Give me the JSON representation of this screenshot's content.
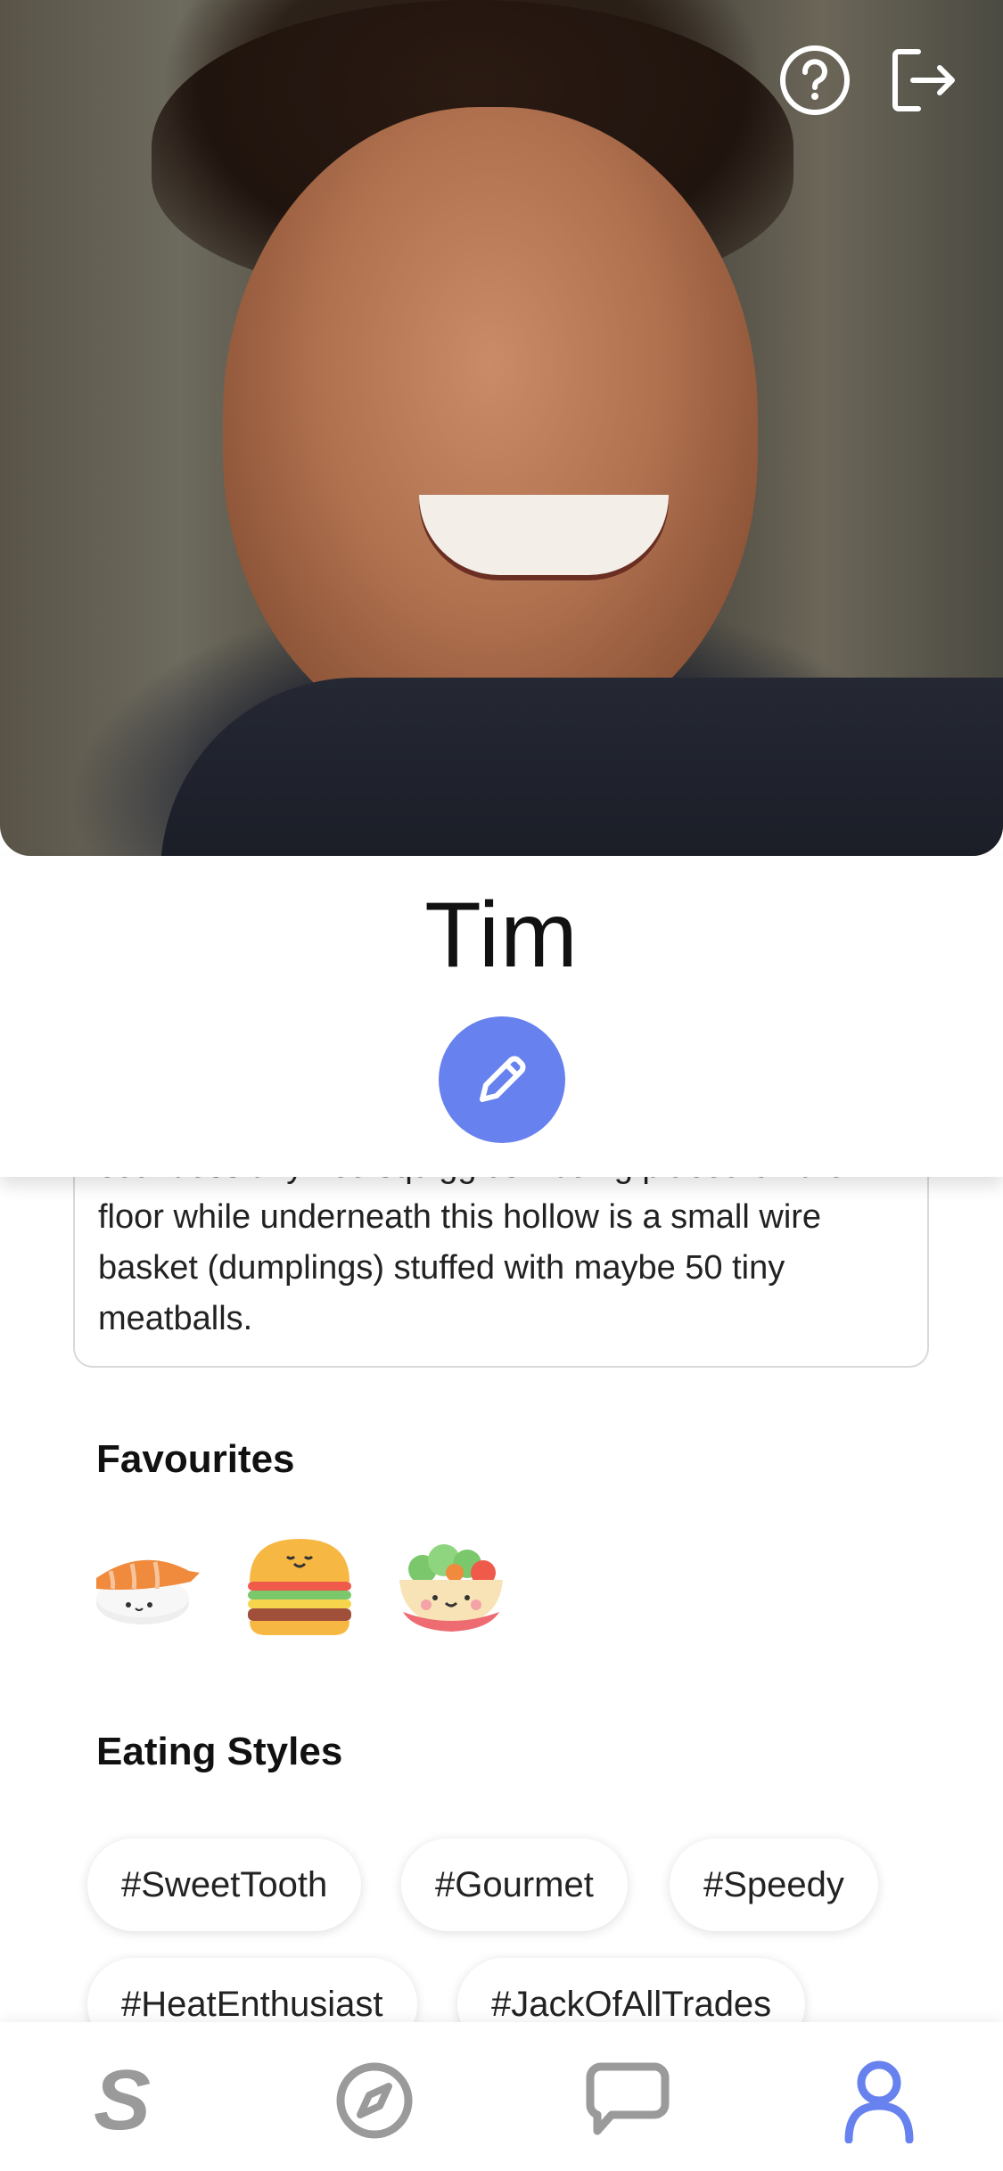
{
  "profile": {
    "name": "Tim",
    "bio": "countless tiny rice squiggles - being placed on the floor while underneath this hollow is a small wire basket (dumplings) stuffed with maybe 50 tiny meatballs."
  },
  "header": {
    "help_icon": "help-circle-icon",
    "logout_icon": "logout-icon"
  },
  "favourites": {
    "title": "Favourites",
    "items": [
      "sushi",
      "burger",
      "salad"
    ]
  },
  "eating_styles": {
    "title": "Eating Styles",
    "tags": [
      "#SweetTooth",
      "#Gourmet",
      "#Speedy",
      "#HeatEnthusiast",
      "#JackOfAllTrades"
    ]
  },
  "nav": {
    "items": [
      "home",
      "explore",
      "messages",
      "profile"
    ],
    "active": "profile"
  },
  "colors": {
    "accent": "#6781ef",
    "nav_inactive": "#9a9a9a"
  }
}
